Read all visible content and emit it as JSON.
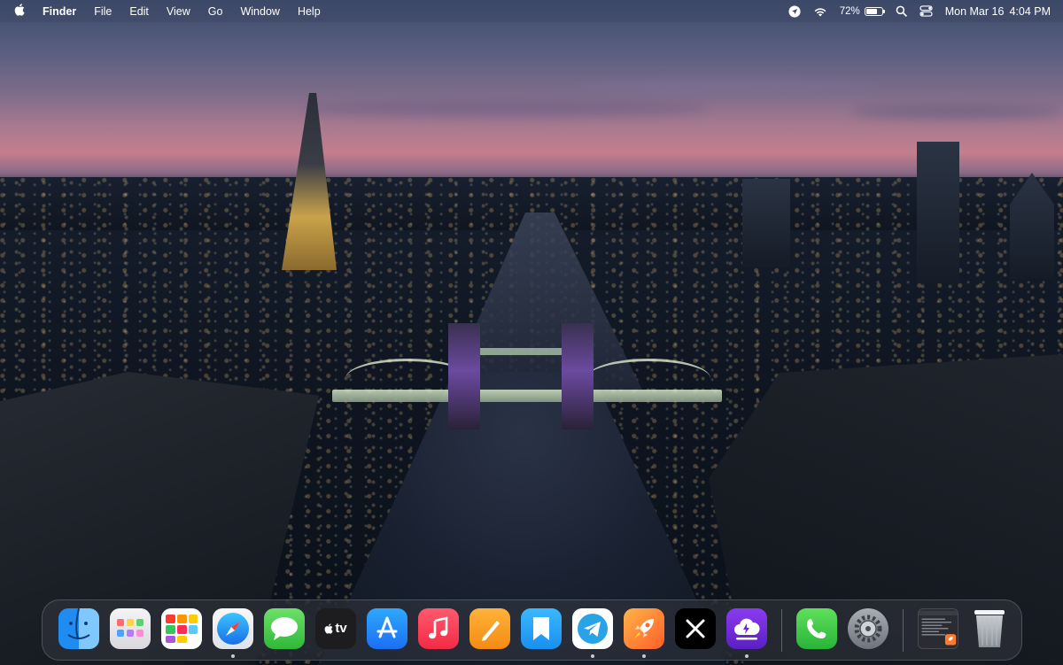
{
  "menubar": {
    "apple_icon": "apple-icon",
    "app_name": "Finder",
    "menus": [
      "File",
      "Edit",
      "View",
      "Go",
      "Window",
      "Help"
    ],
    "status": {
      "location_icon": "location-arrow-icon",
      "wifi_icon": "wifi-icon",
      "battery_percent": "72%",
      "battery_level": 0.72,
      "search_icon": "spotlight-search-icon",
      "control_center_icon": "control-center-icon",
      "date": "Mon Mar 16",
      "time": "4:04 PM"
    }
  },
  "dock": {
    "apps": [
      {
        "name": "Finder",
        "icon": "finder-icon",
        "running": true
      },
      {
        "name": "Launchpad",
        "icon": "launchpad-icon",
        "running": false
      },
      {
        "name": "Calendar",
        "icon": "calendar-icon",
        "running": false
      },
      {
        "name": "Safari",
        "icon": "safari-icon",
        "running": true
      },
      {
        "name": "Messages",
        "icon": "messages-icon",
        "running": false
      },
      {
        "name": "Apple TV",
        "icon": "apple-tv-icon",
        "running": false,
        "label": "tv"
      },
      {
        "name": "App Store",
        "icon": "app-store-icon",
        "running": false
      },
      {
        "name": "Music",
        "icon": "music-icon",
        "running": false
      },
      {
        "name": "Pages",
        "icon": "pages-icon",
        "running": false
      },
      {
        "name": "Bookmarks",
        "icon": "bookmark-icon",
        "running": false
      },
      {
        "name": "Telegram",
        "icon": "telegram-icon",
        "running": true
      },
      {
        "name": "Rocket",
        "icon": "rocket-icon",
        "running": true
      },
      {
        "name": "X",
        "icon": "x-icon",
        "running": false
      },
      {
        "name": "VPN",
        "icon": "cloud-vpn-icon",
        "running": true
      },
      {
        "name": "Phone",
        "icon": "phone-icon",
        "running": false
      },
      {
        "name": "System Settings",
        "icon": "settings-gear-icon",
        "running": false
      },
      {
        "name": "Recent Document",
        "icon": "recent-document-thumbnail-icon",
        "running": false
      },
      {
        "name": "Trash",
        "icon": "trash-icon",
        "running": false
      }
    ]
  },
  "colors": {
    "menubar_text": "#ffffff",
    "dock_bg": "rgba(60,62,70,.45)"
  }
}
